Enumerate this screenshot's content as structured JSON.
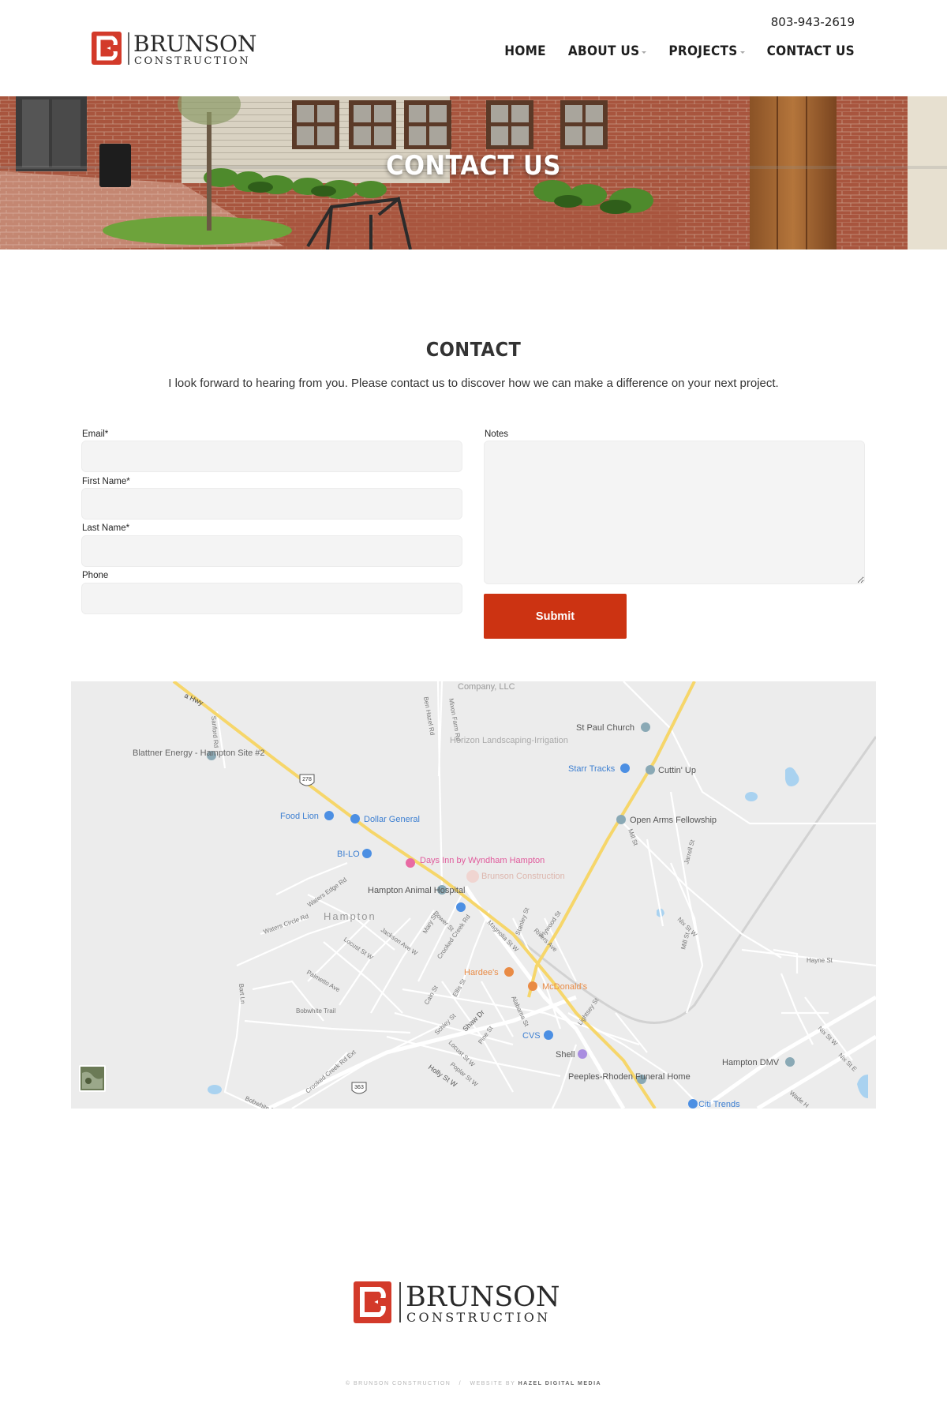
{
  "header": {
    "phone": "803-943-2619",
    "logo_word": "BRUNSON",
    "logo_sub": "CONSTRUCTION",
    "nav": [
      {
        "label": "HOME",
        "dropdown": false
      },
      {
        "label": "ABOUT US",
        "dropdown": true
      },
      {
        "label": "PROJECTS",
        "dropdown": true
      },
      {
        "label": "CONTACT US",
        "dropdown": false
      }
    ]
  },
  "hero": {
    "title": "CONTACT US"
  },
  "contact": {
    "title": "CONTACT",
    "intro": "I look forward to hearing from you. Please contact us to discover how we can make a difference on your next project."
  },
  "form": {
    "email_label": "Email*",
    "first_name_label": "First Name*",
    "last_name_label": "Last Name*",
    "phone_label": "Phone",
    "notes_label": "Notes",
    "submit_label": "Submit"
  },
  "map": {
    "labels": {
      "hwy": "a Hwy",
      "company": "Company, LLC",
      "ben_hazel_rd": "Ben Hazel Rd",
      "mixon_farm": "Mixon Farm Rd",
      "horizon": "Horizon Landscaping-Irrigation",
      "st_paul": "St Paul Church",
      "blattner": "Blattner Energy - Hampton Site #2",
      "sanford": "Sanford Rd",
      "route_278": "278",
      "starr": "Starr Tracks",
      "cuttin": "Cuttin' Up",
      "food_lion": "Food Lion",
      "dollar_general": "Dollar General",
      "open_arms": "Open Arms Fellowship",
      "mill_st": "Mill St",
      "jarrell": "Jarrell St",
      "bilo": "BI-LO",
      "days_inn": "Days Inn by Wyndham Hampton",
      "brunson_map": "Brunson Construction",
      "animal_hospital": "Hampton Animal Hospital",
      "hampton": "Hampton",
      "waters_edge": "Waters Edge Rd",
      "waters_circle": "Waters Circle Rd",
      "locust": "Locust St W",
      "jackson": "Jackson Ave W",
      "mary": "Mary St",
      "crooked_creek": "Crooked Creek Rd",
      "magnolia": "Magnolia St W",
      "stanley": "Stanley St",
      "plywood": "Plywood St",
      "rivers": "Rivers Ave",
      "nix": "Nix St W",
      "hayne": "Hayne St",
      "power": "Power St",
      "hardees": "Hardee's",
      "mcdonalds": "McDonald's",
      "palmetto": "Palmetto Ave",
      "bart": "Bart Ln",
      "bobwhite": "Bobwhite Trail",
      "cain": "Cain St",
      "ellis": "Ellis St",
      "alabama": "Alabama St",
      "lightsey": "Lightsey St",
      "schley": "Schley St",
      "shaw": "Shaw Dr",
      "pine": "Pine St",
      "cvs": "CVS",
      "shell": "Shell",
      "hampton_dmv": "Hampton DMV",
      "poplar": "Poplar St W",
      "holly": "Holly St W",
      "peeples": "Peeples-Rhoden Funeral Home",
      "citi_trends": "Citi Trends",
      "route_363": "363",
      "crooked_creek_ext": "Crooked Creek Rd Ext",
      "bobwhite_trl": "Bobwhite Tr",
      "wade": "Wade H",
      "mill_st_2": "Mill St",
      "nix_st": "Nix St W",
      "nix_e": "Nix St E"
    }
  },
  "footer": {
    "logo_word": "BRUNSON",
    "logo_sub": "CONSTRUCTION",
    "copyright": "© BRUNSON CONSTRUCTION",
    "sep": "/",
    "credit_prefix": "WEBSITE BY",
    "credit_name": "HAZEL DIGITAL MEDIA"
  },
  "colors": {
    "brand_red": "#cc3312",
    "logo_red": "#d33a2a",
    "map_bg": "#ececec",
    "highway": "#f6d66a"
  },
  "icons": [
    "logo-icon",
    "map-satellite-thumbnail-icon",
    "map-pin-icon"
  ]
}
